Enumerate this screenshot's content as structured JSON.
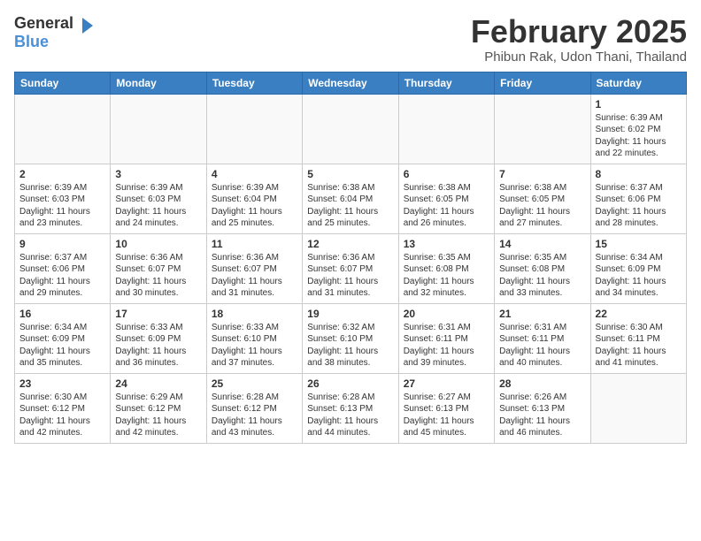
{
  "header": {
    "logo_general": "General",
    "logo_blue": "Blue",
    "month_year": "February 2025",
    "location": "Phibun Rak, Udon Thani, Thailand"
  },
  "weekdays": [
    "Sunday",
    "Monday",
    "Tuesday",
    "Wednesday",
    "Thursday",
    "Friday",
    "Saturday"
  ],
  "weeks": [
    [
      {
        "day": "",
        "info": ""
      },
      {
        "day": "",
        "info": ""
      },
      {
        "day": "",
        "info": ""
      },
      {
        "day": "",
        "info": ""
      },
      {
        "day": "",
        "info": ""
      },
      {
        "day": "",
        "info": ""
      },
      {
        "day": "1",
        "info": "Sunrise: 6:39 AM\nSunset: 6:02 PM\nDaylight: 11 hours\nand 22 minutes."
      }
    ],
    [
      {
        "day": "2",
        "info": "Sunrise: 6:39 AM\nSunset: 6:03 PM\nDaylight: 11 hours\nand 23 minutes."
      },
      {
        "day": "3",
        "info": "Sunrise: 6:39 AM\nSunset: 6:03 PM\nDaylight: 11 hours\nand 24 minutes."
      },
      {
        "day": "4",
        "info": "Sunrise: 6:39 AM\nSunset: 6:04 PM\nDaylight: 11 hours\nand 25 minutes."
      },
      {
        "day": "5",
        "info": "Sunrise: 6:38 AM\nSunset: 6:04 PM\nDaylight: 11 hours\nand 25 minutes."
      },
      {
        "day": "6",
        "info": "Sunrise: 6:38 AM\nSunset: 6:05 PM\nDaylight: 11 hours\nand 26 minutes."
      },
      {
        "day": "7",
        "info": "Sunrise: 6:38 AM\nSunset: 6:05 PM\nDaylight: 11 hours\nand 27 minutes."
      },
      {
        "day": "8",
        "info": "Sunrise: 6:37 AM\nSunset: 6:06 PM\nDaylight: 11 hours\nand 28 minutes."
      }
    ],
    [
      {
        "day": "9",
        "info": "Sunrise: 6:37 AM\nSunset: 6:06 PM\nDaylight: 11 hours\nand 29 minutes."
      },
      {
        "day": "10",
        "info": "Sunrise: 6:36 AM\nSunset: 6:07 PM\nDaylight: 11 hours\nand 30 minutes."
      },
      {
        "day": "11",
        "info": "Sunrise: 6:36 AM\nSunset: 6:07 PM\nDaylight: 11 hours\nand 31 minutes."
      },
      {
        "day": "12",
        "info": "Sunrise: 6:36 AM\nSunset: 6:07 PM\nDaylight: 11 hours\nand 31 minutes."
      },
      {
        "day": "13",
        "info": "Sunrise: 6:35 AM\nSunset: 6:08 PM\nDaylight: 11 hours\nand 32 minutes."
      },
      {
        "day": "14",
        "info": "Sunrise: 6:35 AM\nSunset: 6:08 PM\nDaylight: 11 hours\nand 33 minutes."
      },
      {
        "day": "15",
        "info": "Sunrise: 6:34 AM\nSunset: 6:09 PM\nDaylight: 11 hours\nand 34 minutes."
      }
    ],
    [
      {
        "day": "16",
        "info": "Sunrise: 6:34 AM\nSunset: 6:09 PM\nDaylight: 11 hours\nand 35 minutes."
      },
      {
        "day": "17",
        "info": "Sunrise: 6:33 AM\nSunset: 6:09 PM\nDaylight: 11 hours\nand 36 minutes."
      },
      {
        "day": "18",
        "info": "Sunrise: 6:33 AM\nSunset: 6:10 PM\nDaylight: 11 hours\nand 37 minutes."
      },
      {
        "day": "19",
        "info": "Sunrise: 6:32 AM\nSunset: 6:10 PM\nDaylight: 11 hours\nand 38 minutes."
      },
      {
        "day": "20",
        "info": "Sunrise: 6:31 AM\nSunset: 6:11 PM\nDaylight: 11 hours\nand 39 minutes."
      },
      {
        "day": "21",
        "info": "Sunrise: 6:31 AM\nSunset: 6:11 PM\nDaylight: 11 hours\nand 40 minutes."
      },
      {
        "day": "22",
        "info": "Sunrise: 6:30 AM\nSunset: 6:11 PM\nDaylight: 11 hours\nand 41 minutes."
      }
    ],
    [
      {
        "day": "23",
        "info": "Sunrise: 6:30 AM\nSunset: 6:12 PM\nDaylight: 11 hours\nand 42 minutes."
      },
      {
        "day": "24",
        "info": "Sunrise: 6:29 AM\nSunset: 6:12 PM\nDaylight: 11 hours\nand 42 minutes."
      },
      {
        "day": "25",
        "info": "Sunrise: 6:28 AM\nSunset: 6:12 PM\nDaylight: 11 hours\nand 43 minutes."
      },
      {
        "day": "26",
        "info": "Sunrise: 6:28 AM\nSunset: 6:13 PM\nDaylight: 11 hours\nand 44 minutes."
      },
      {
        "day": "27",
        "info": "Sunrise: 6:27 AM\nSunset: 6:13 PM\nDaylight: 11 hours\nand 45 minutes."
      },
      {
        "day": "28",
        "info": "Sunrise: 6:26 AM\nSunset: 6:13 PM\nDaylight: 11 hours\nand 46 minutes."
      },
      {
        "day": "",
        "info": ""
      }
    ]
  ]
}
